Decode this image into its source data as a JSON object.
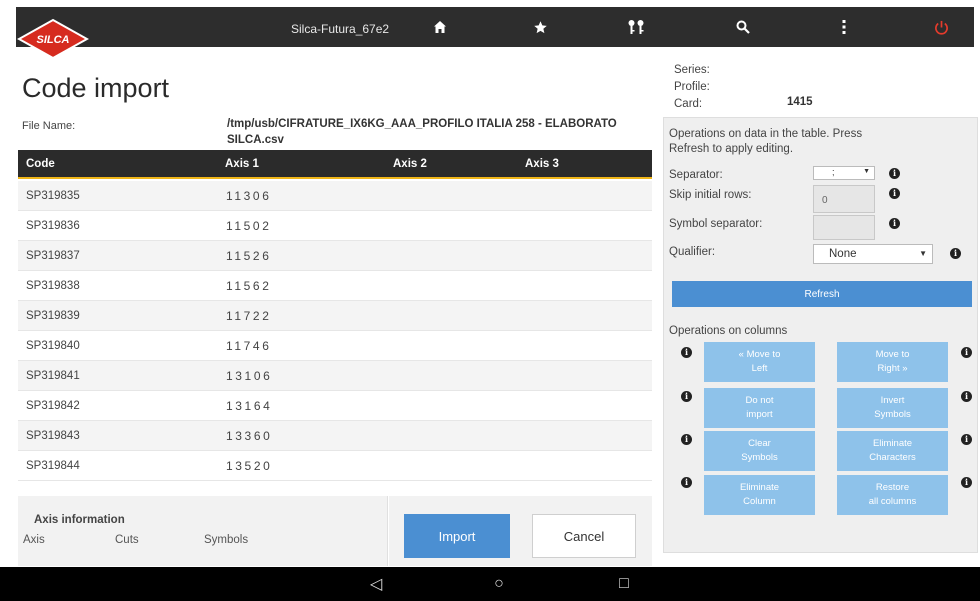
{
  "header": {
    "device_title": "Silca-Futura_67e2",
    "logo_text": "SILCA",
    "icons": [
      "home-icon",
      "star-icon",
      "keys-icon",
      "search-icon",
      "menu-icon",
      "power-icon"
    ],
    "power_color": "#e43b2c"
  },
  "page": {
    "title": "Code import",
    "file_label": "File Name:",
    "file_value": "/tmp/usb/CIFRATURE_IX6KG_AAA_PROFILO ITALIA 258 - ELABORATO SILCA.csv"
  },
  "table": {
    "headers": [
      "Code",
      "Axis 1",
      "Axis 2",
      "Axis 3"
    ],
    "rows": [
      {
        "code": "SP319835",
        "axis1": "11306"
      },
      {
        "code": "SP319836",
        "axis1": "11502"
      },
      {
        "code": "SP319837",
        "axis1": "11526"
      },
      {
        "code": "SP319838",
        "axis1": "11562"
      },
      {
        "code": "SP319839",
        "axis1": "11722"
      },
      {
        "code": "SP319840",
        "axis1": "11746"
      },
      {
        "code": "SP319841",
        "axis1": "13106"
      },
      {
        "code": "SP319842",
        "axis1": "13164"
      },
      {
        "code": "SP319843",
        "axis1": "13360"
      },
      {
        "code": "SP319844",
        "axis1": "13520"
      }
    ]
  },
  "axis_info": {
    "title": "Axis information",
    "col_axis": "Axis",
    "col_cuts": "Cuts",
    "col_symbols": "Symbols"
  },
  "actions": {
    "import_label": "Import",
    "cancel_label": "Cancel",
    "accent": "#4b8fd2"
  },
  "info": {
    "series_label": "Series:",
    "profile_label": "Profile:",
    "card_label": "Card:",
    "card_value": "1415"
  },
  "operations": {
    "description": "Operations on data in the table. Press Refresh to apply editing.",
    "separator_label": "Separator:",
    "separator_value": ";",
    "skip_label": "Skip initial rows:",
    "skip_value": "0",
    "symbol_separator_label": "Symbol separator:",
    "qualifier_label": "Qualifier:",
    "qualifier_value": "None",
    "refresh_label": "Refresh",
    "columns_title": "Operations on columns",
    "buttons": {
      "move_left": "« Move to\nLeft",
      "move_right": "Move to\nRight »",
      "do_not_import": "Do not\nimport",
      "invert": "Invert\nSymbols",
      "clear": "Clear\nSymbols",
      "eliminate_chars": "Eliminate\nCharacters",
      "eliminate_column": "Eliminate\nColumn",
      "restore": "Restore\nall columns"
    }
  },
  "nav": {
    "back": "◁",
    "home": "○",
    "recent": "□"
  }
}
